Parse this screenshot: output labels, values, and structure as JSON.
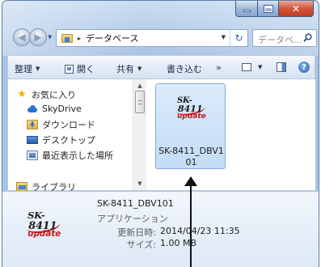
{
  "address_bar": {
    "folder_name": "データベース",
    "separator": "▸"
  },
  "search": {
    "placeholder": "データベ..."
  },
  "command_bar": {
    "organize": "整理",
    "open": "開く",
    "share": "共有",
    "burn": "書き込む",
    "more": "»"
  },
  "nav_pane": {
    "items": [
      {
        "label": "お気に入り",
        "icon": "star-icon"
      },
      {
        "label": "SkyDrive",
        "icon": "skydrive-icon"
      },
      {
        "label": "ダウンロード",
        "icon": "downloads-folder-icon"
      },
      {
        "label": "デスクトップ",
        "icon": "desktop-icon"
      },
      {
        "label": "最近表示した場所",
        "icon": "recent-places-icon"
      },
      {
        "label": "ライブラリ",
        "icon": "library-icon"
      }
    ]
  },
  "file": {
    "name_line1": "SK-8411_DBV1",
    "name_line2": "01",
    "icon_text": {
      "line1": "SK-",
      "line2": "8411",
      "line3": "update"
    }
  },
  "details": {
    "title": "SK-8411_DBV101",
    "type": "アプリケーション",
    "modified_label": "更新日時:",
    "modified_value": "2014/04/23 11:35",
    "size_label": "サイズ:",
    "size_value": "1.00 MB"
  },
  "colors": {
    "selection": "#cde4fa",
    "accent": "#2b73c9",
    "close_button": "#c8482c",
    "annotation_arrow": "#111111"
  }
}
